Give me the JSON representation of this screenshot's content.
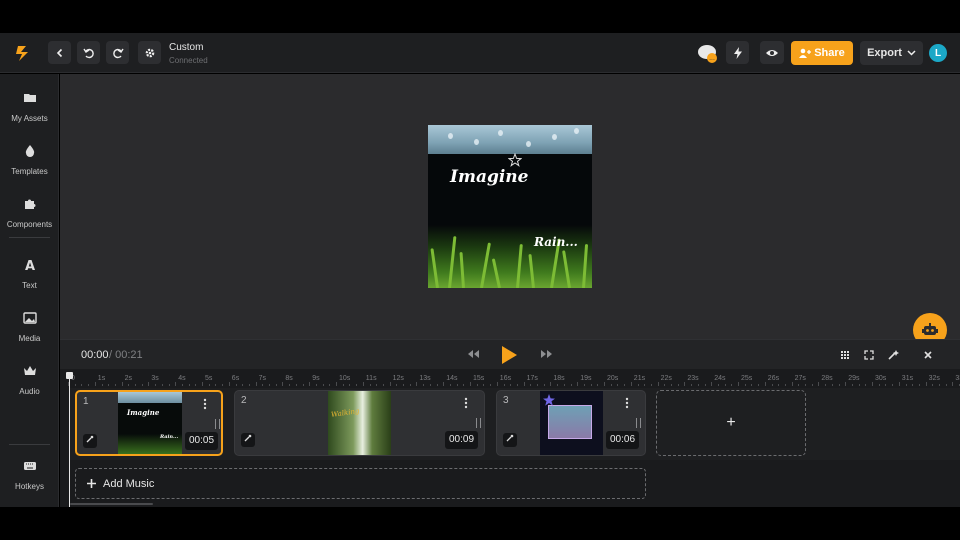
{
  "topbar": {
    "project_name": "Custom",
    "project_status": "Connected",
    "share_label": "Share",
    "export_label": "Export",
    "avatar_initial": "L"
  },
  "sidebar": {
    "items": [
      {
        "label": "My Assets",
        "icon": "folder-icon"
      },
      {
        "label": "Templates",
        "icon": "droplet-icon"
      },
      {
        "label": "Components",
        "icon": "puzzle-icon"
      },
      {
        "label": "Text",
        "icon": "text-a-icon"
      },
      {
        "label": "Media",
        "icon": "image-icon"
      },
      {
        "label": "Audio",
        "icon": "crown-icon"
      },
      {
        "label": "Hotkeys",
        "icon": "keyboard-icon"
      }
    ]
  },
  "preview": {
    "title_text": "Imagine",
    "subtitle_text": "Rain..."
  },
  "playback": {
    "current_time": "00:00",
    "total_time": "/ 00:21"
  },
  "ruler": {
    "ticks": [
      "0",
      "1s",
      "2s",
      "3s",
      "4s",
      "5s",
      "6s",
      "7s",
      "8s",
      "9s",
      "10s",
      "11s",
      "12s",
      "13s",
      "14s",
      "15s",
      "16s",
      "17s",
      "18s",
      "19s",
      "20s",
      "21s",
      "22s",
      "23s",
      "24s",
      "25s",
      "26s",
      "27s",
      "28s",
      "29s",
      "30s",
      "31s",
      "32s",
      "33s"
    ]
  },
  "clips": [
    {
      "number": "1",
      "duration": "00:05",
      "thumb_title": "Imagine",
      "thumb_sub": "Rain..."
    },
    {
      "number": "2",
      "duration": "00:09",
      "thumb_title": "Walking"
    },
    {
      "number": "3",
      "duration": "00:06"
    }
  ],
  "add_clip_label": "+",
  "music": {
    "label": "Add Music"
  },
  "colors": {
    "accent": "#f7a21b",
    "avatar": "#1ba8c7",
    "background": "#1e1f21"
  }
}
